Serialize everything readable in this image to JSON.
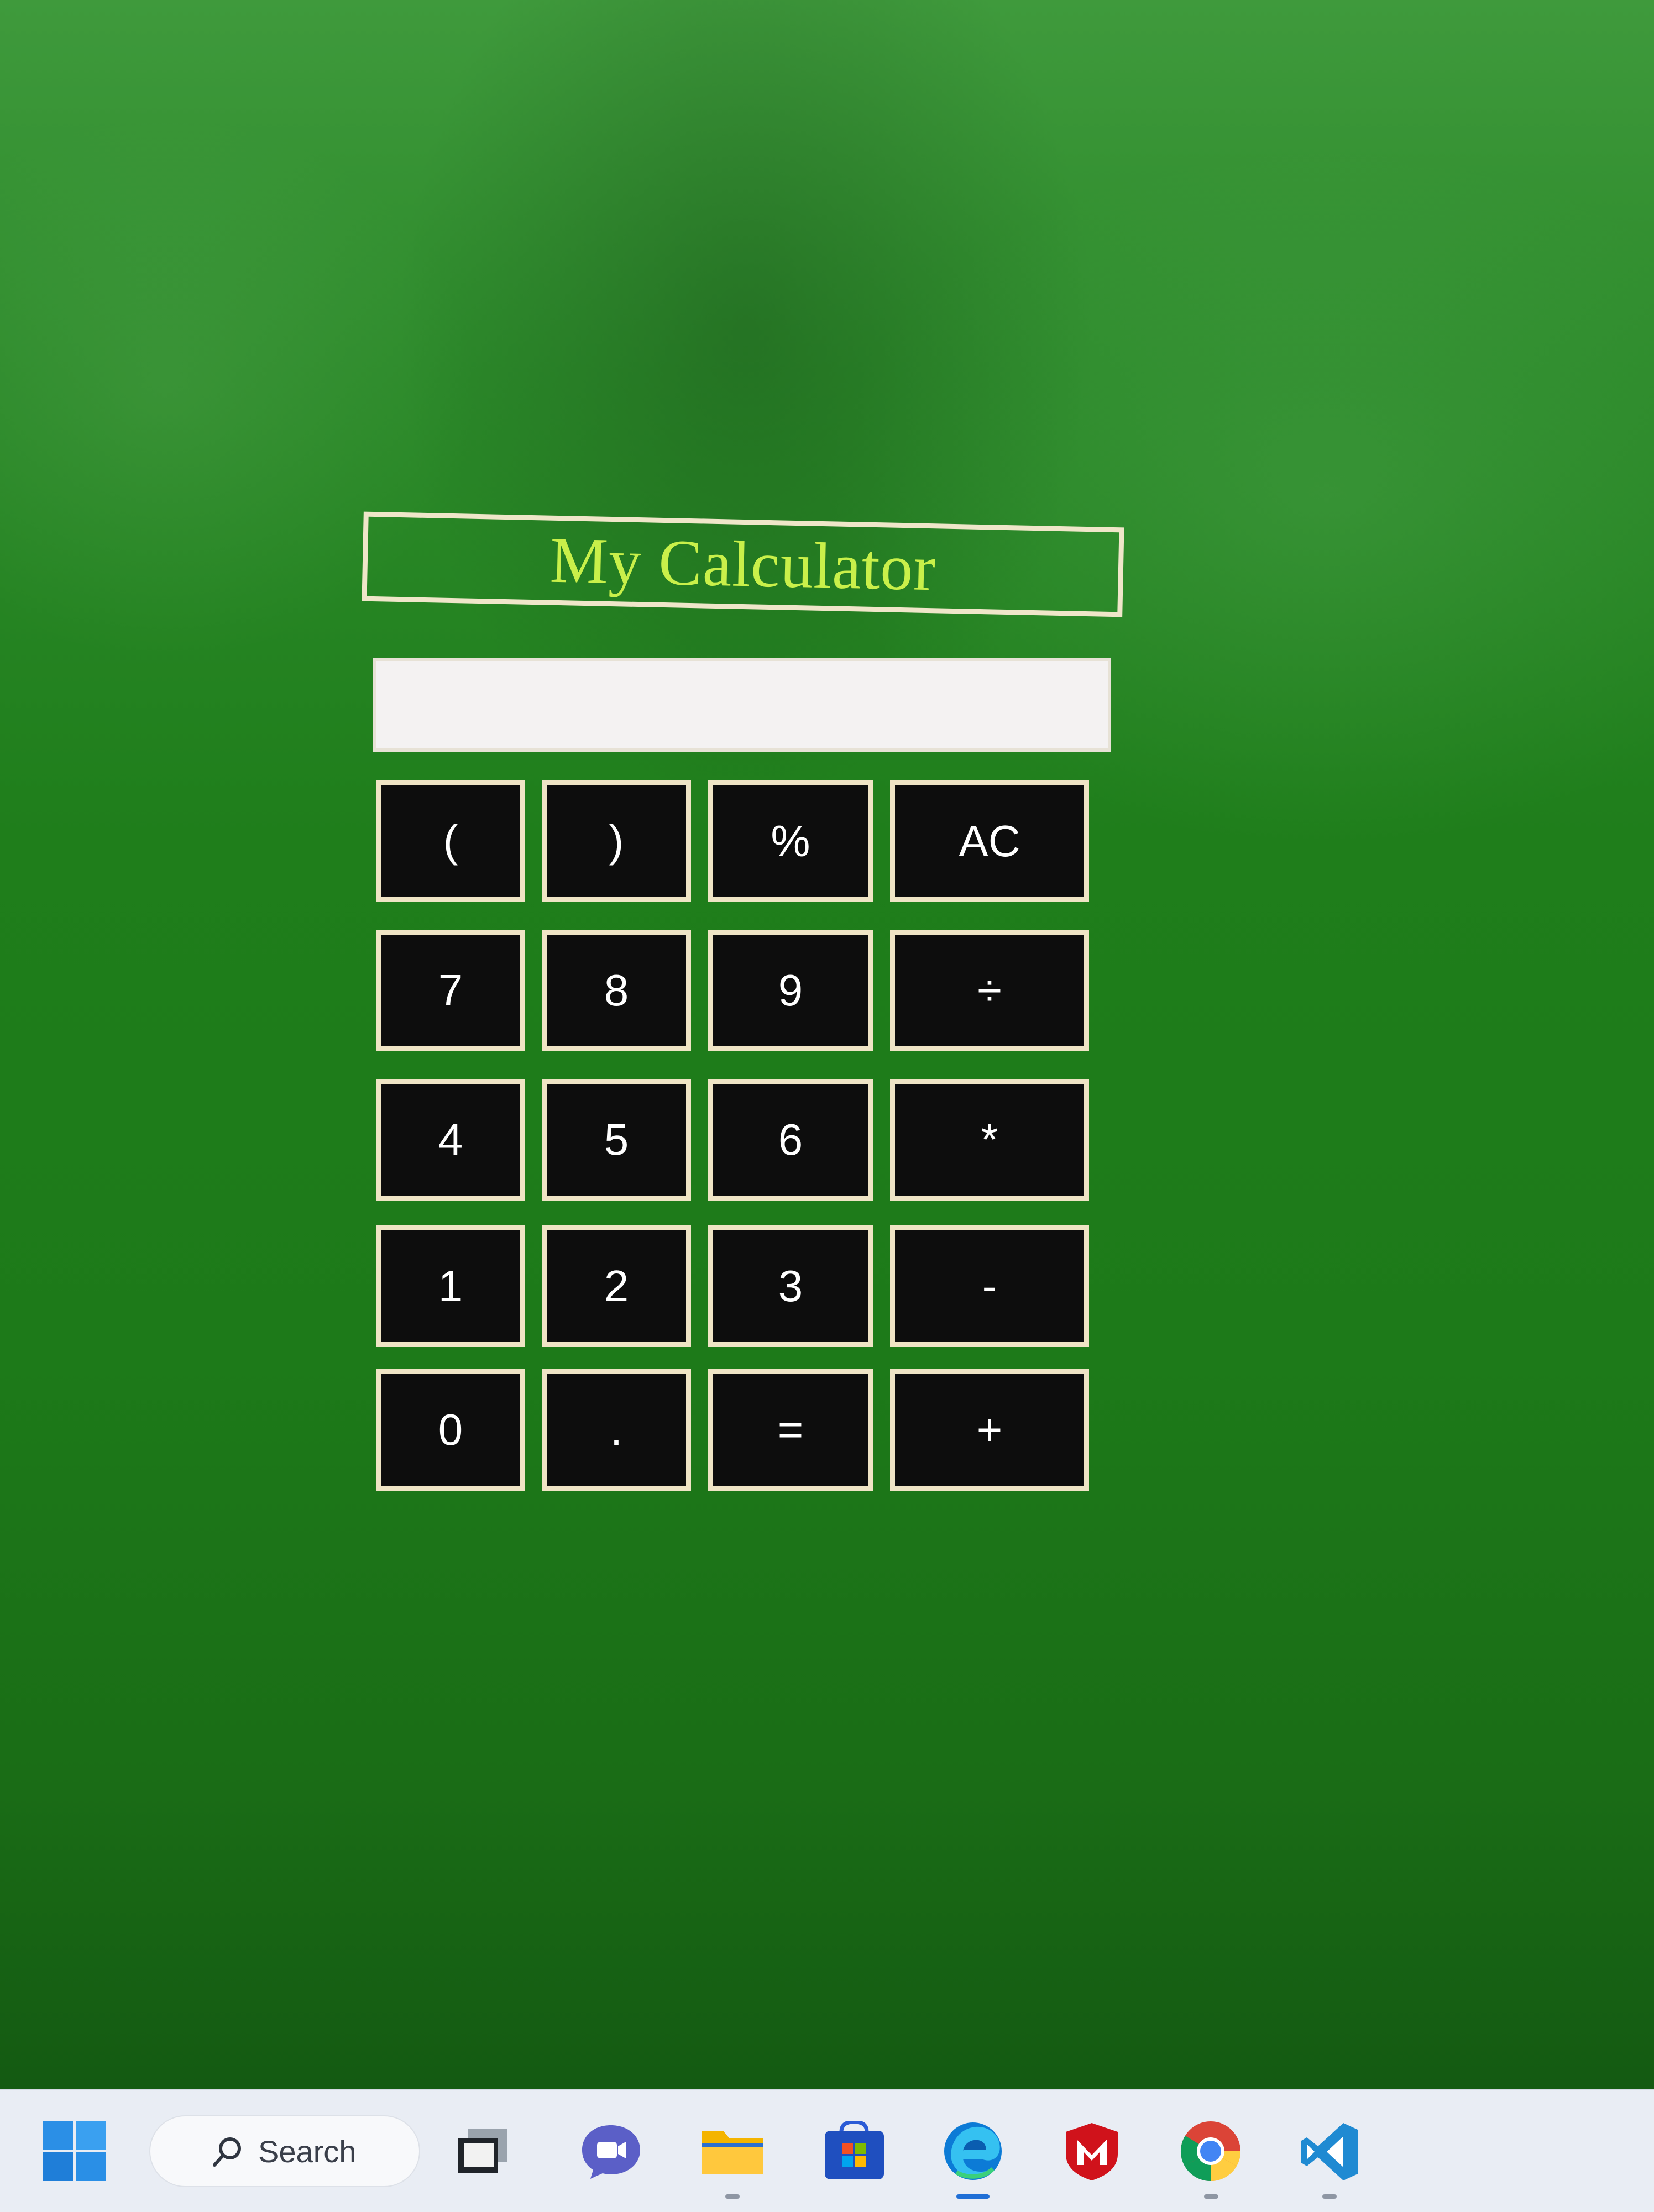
{
  "calculator": {
    "title": "My Calculator",
    "display_value": "",
    "keys": [
      "(",
      ")",
      "%",
      "AC",
      "7",
      "8",
      "9",
      "÷",
      "4",
      "5",
      "6",
      "*",
      "1",
      "2",
      "3",
      "-",
      "0",
      ".",
      "=",
      "+"
    ]
  },
  "taskbar": {
    "search_label": "Search",
    "apps": [
      "start-icon",
      "task-view-icon",
      "teams-chat-icon",
      "file-explorer-icon",
      "microsoft-store-icon",
      "edge-icon",
      "mcafee-icon",
      "chrome-icon",
      "vscode-icon"
    ]
  },
  "colors": {
    "background": "#1e7f1b",
    "title_text": "#c9f04a",
    "key_background": "#0d0d0d",
    "key_border": "#efe4c5",
    "display_background": "#f4f2f2",
    "taskbar_background": "#e9edf4"
  }
}
